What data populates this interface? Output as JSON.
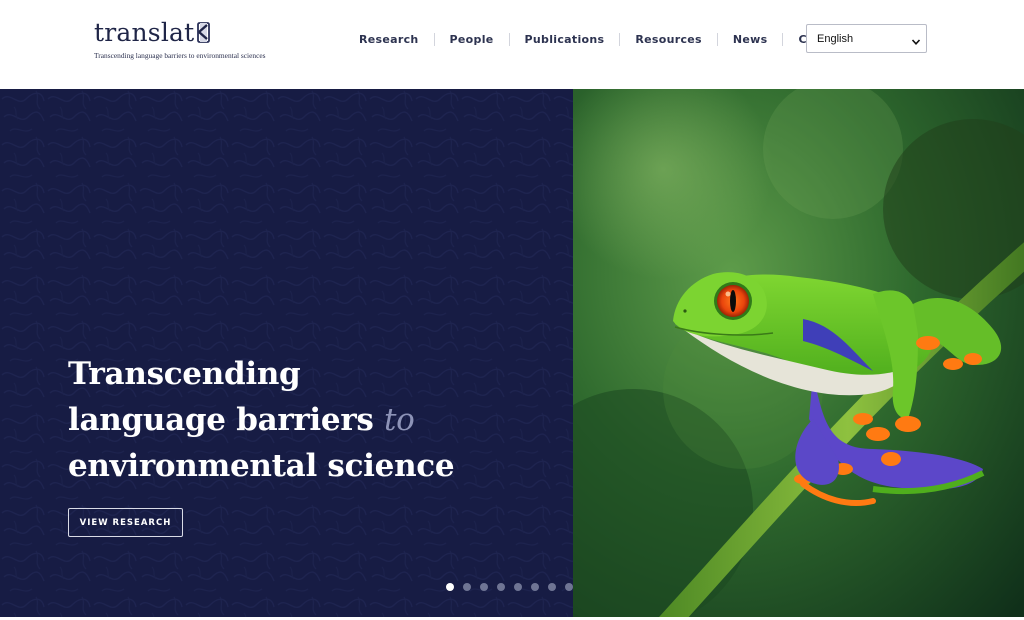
{
  "brand": {
    "name": "translat",
    "tagline": "Transcending language barriers to environmental sciences"
  },
  "nav": {
    "items": [
      {
        "label": "Research"
      },
      {
        "label": "People"
      },
      {
        "label": "Publications"
      },
      {
        "label": "Resources"
      },
      {
        "label": "News"
      },
      {
        "label": "Contact"
      }
    ]
  },
  "language_select": {
    "selected": "English",
    "icon": "chevron-down-icon"
  },
  "hero": {
    "title_line1": "Transcending",
    "title_line2": "language barriers",
    "title_accent": "to",
    "title_line3": "environmental science",
    "cta_label": "VIEW RESEARCH",
    "slides_total": 8,
    "active_slide": 1,
    "image": "red-eyed-tree-frog-on-green-stem"
  },
  "colors": {
    "navy": "#171c44",
    "accent_text": "#8d93b7",
    "nav_text": "#2d3350"
  }
}
